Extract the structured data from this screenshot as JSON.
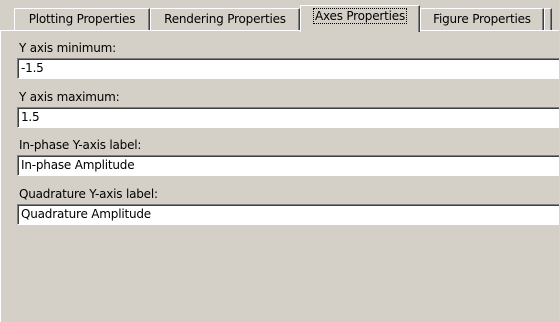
{
  "tabs": [
    {
      "label": "Plotting Properties",
      "active": false
    },
    {
      "label": "Rendering Properties",
      "active": false
    },
    {
      "label": "Axes Properties",
      "active": true
    },
    {
      "label": "Figure Properties",
      "active": false
    }
  ],
  "fields": [
    {
      "label": "Y axis minimum:",
      "value": "-1.5"
    },
    {
      "label": "Y axis maximum:",
      "value": "1.5"
    },
    {
      "label": "In-phase Y-axis label:",
      "value": "In-phase Amplitude"
    },
    {
      "label": "Quadrature Y-axis label:",
      "value": "Quadrature Amplitude"
    }
  ]
}
